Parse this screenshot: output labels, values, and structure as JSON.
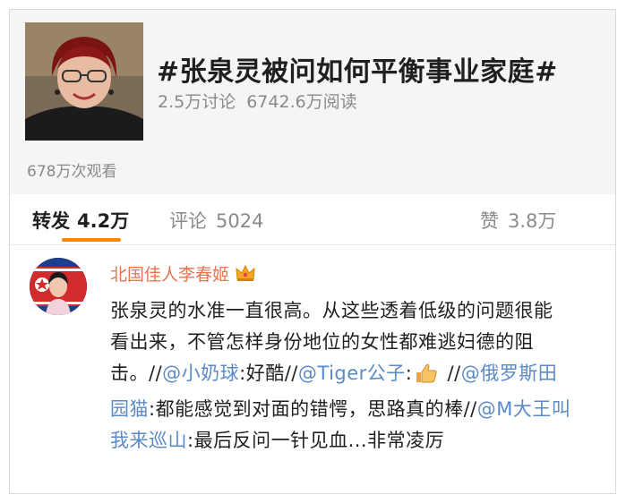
{
  "topic": {
    "title": "#张泉灵被问如何平衡事业家庭#",
    "discussions": "2.5万讨论",
    "reads": "6742.6万阅读",
    "views": "678万次观看"
  },
  "tabs": {
    "repost_label": "转发",
    "repost_count": "4.2万",
    "comment_label": "评论",
    "comment_count": "5024",
    "like_label": "赞",
    "like_count": "3.8万"
  },
  "comment": {
    "author": "北国佳人李春姬",
    "text_1": "张泉灵的水准一直很高。从这些透着低级的问题很能看出来，不管怎样身份地位的女性都难逃妇德的阻击。//",
    "mention_1": "@小奶球",
    "text_2": ":好酷//",
    "mention_2": "@Tiger公子",
    "text_3": ":",
    "text_4": " //",
    "mention_3": "@俄罗斯田园猫",
    "text_5": ":都能感觉到对面的错愕，思路真的棒//",
    "mention_4": "@M大王叫我来巡山",
    "text_6": ":最后反问一针见血...非常凌厉"
  },
  "icons": [
    "crown-badge-icon",
    "thumbs-up-emoji-icon"
  ],
  "colors": {
    "accent": "#ff8200",
    "name": "#eb7350",
    "mention": "#5b8bc7"
  }
}
